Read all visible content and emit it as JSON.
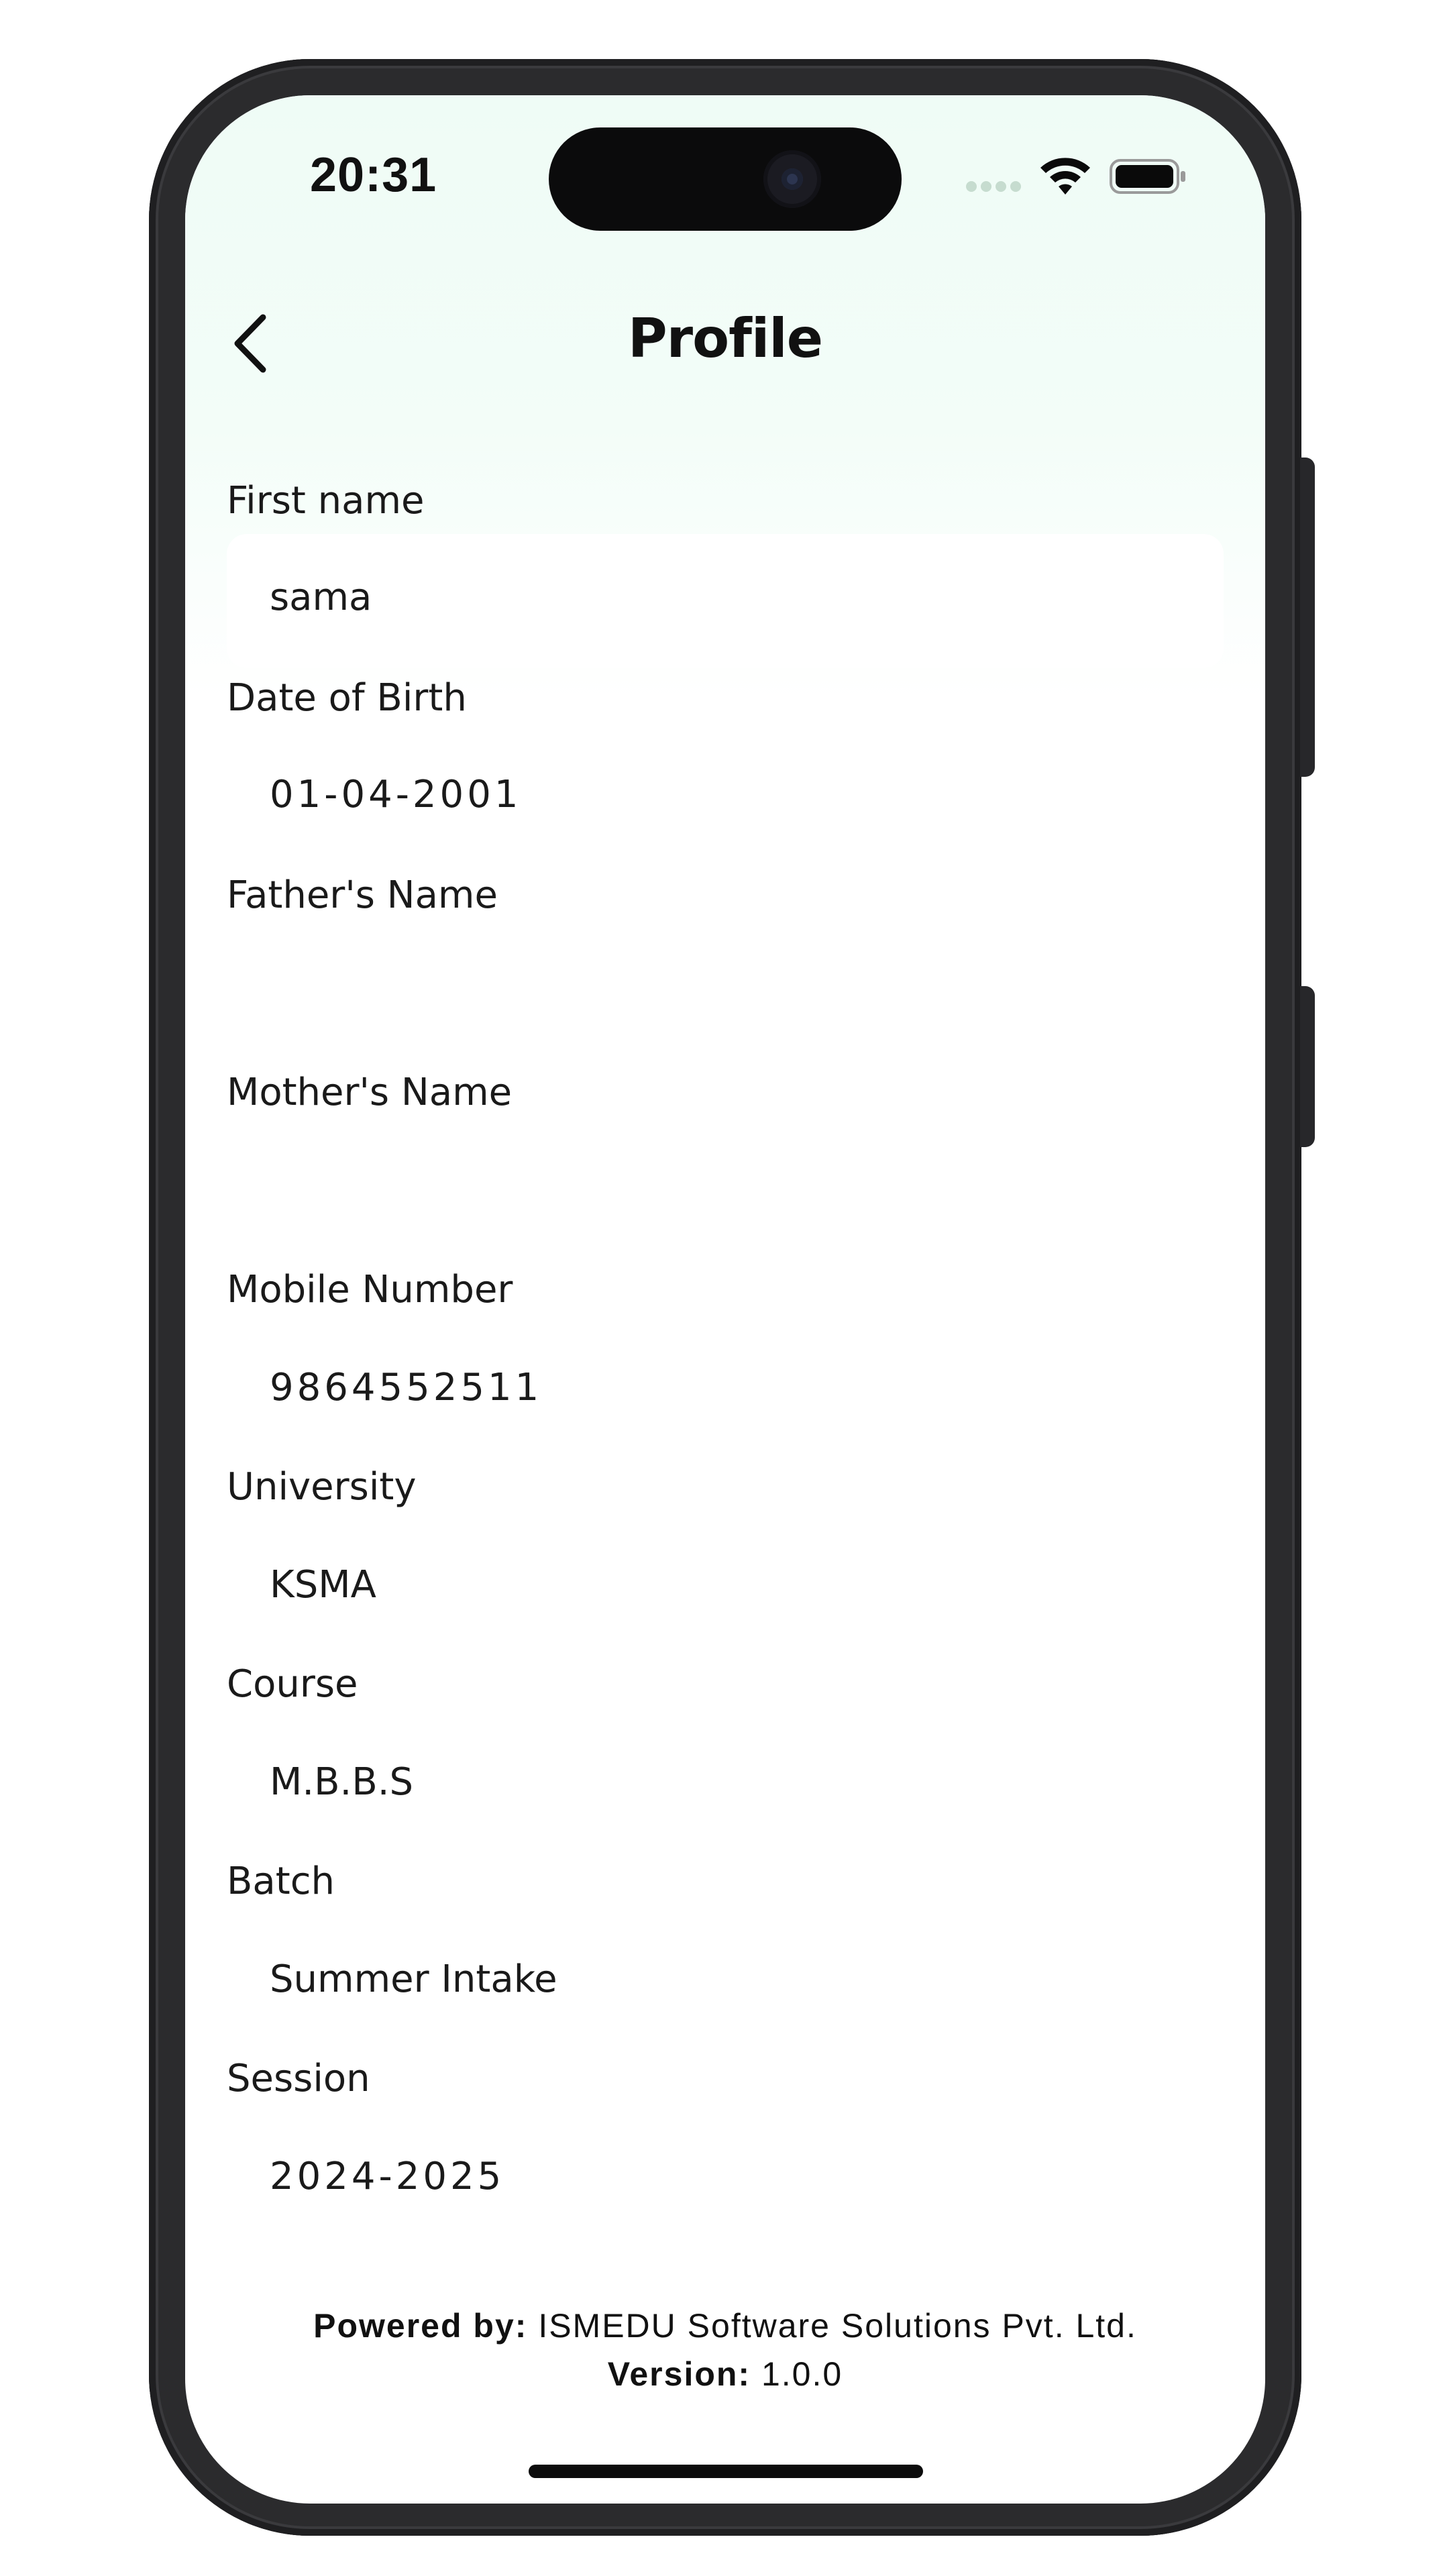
{
  "status_bar": {
    "time": "20:31",
    "icons": [
      "cellular-signal-icon",
      "wifi-icon",
      "battery-icon"
    ]
  },
  "header": {
    "title": "Profile",
    "back_icon": "chevron-left-icon"
  },
  "fields": [
    {
      "label": "First name",
      "value": "sama"
    },
    {
      "label": "Date of Birth",
      "value": "01-04-2001"
    },
    {
      "label": "Father's Name",
      "value": ""
    },
    {
      "label": "Mother's Name",
      "value": ""
    },
    {
      "label": "Mobile Number",
      "value": "9864552511"
    },
    {
      "label": "University",
      "value": "KSMA"
    },
    {
      "label": "Course",
      "value": "M.B.B.S"
    },
    {
      "label": "Batch",
      "value": "Summer Intake"
    },
    {
      "label": "Session",
      "value": "2024-2025"
    }
  ],
  "footer": {
    "powered_by_label": "Powered by:",
    "powered_by_value": "ISMEDU Software Solutions Pvt. Ltd.",
    "version_label": "Version:",
    "version_value": "1.0.0"
  },
  "colors": {
    "header_tint": "#effcf6",
    "text": "#111111",
    "phone_frame": "#2b2b2d"
  }
}
